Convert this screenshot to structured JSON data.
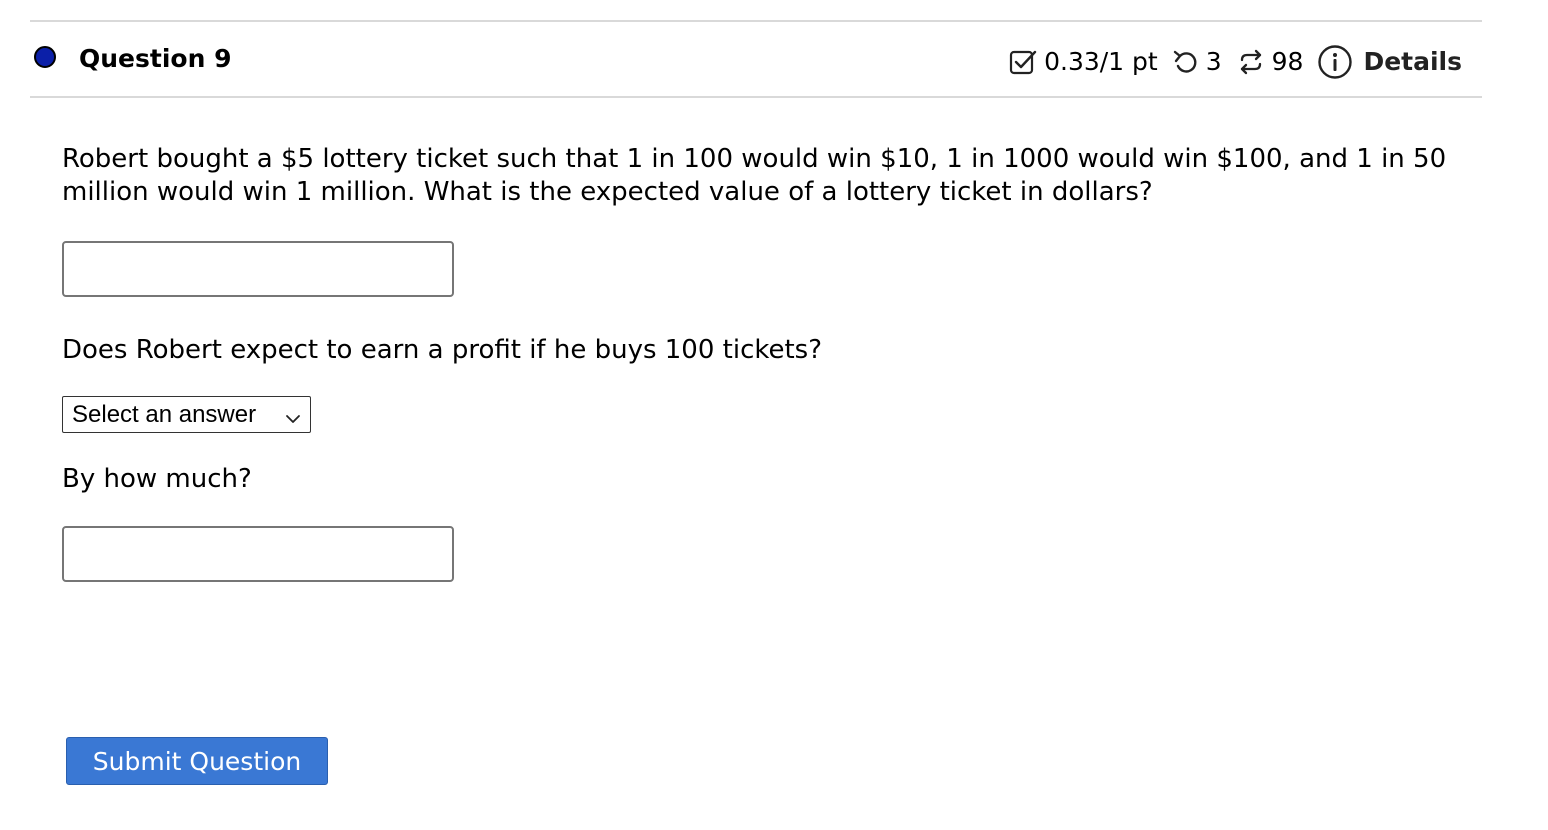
{
  "header": {
    "title": "Question 9",
    "score": "0.33/1 pt",
    "attempts": "3",
    "retries": "98",
    "details_label": "Details",
    "status_color": "#0b1fa8",
    "icons": [
      "checkbox-check-icon",
      "undo-icon",
      "retry-icon",
      "info-icon"
    ]
  },
  "question": {
    "prompt": "Robert bought a $5 lottery ticket such that 1 in 100 would win $10, 1 in 1000 would win $100, and 1 in 50 million would win 1 million. What is the expected value of a lottery ticket in dollars?",
    "answer1_value": "",
    "profit_question": "Does Robert expect to earn a profit if he buys 100 tickets?",
    "select_value": "Select an answer",
    "how_much_label": "By how much?",
    "answer2_value": ""
  },
  "submit": {
    "label": "Submit Question",
    "color": "#3a78d4"
  }
}
